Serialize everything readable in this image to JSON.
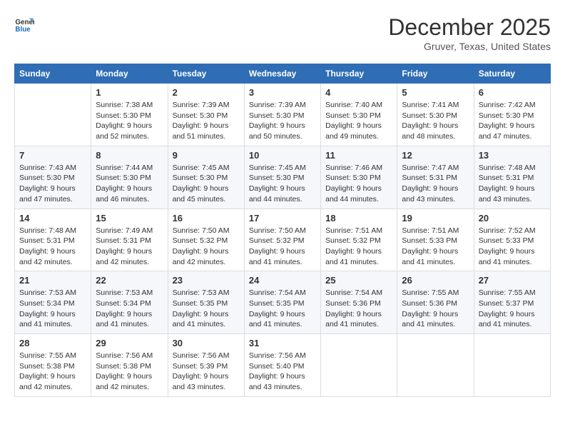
{
  "header": {
    "logo_general": "General",
    "logo_blue": "Blue",
    "month": "December 2025",
    "location": "Gruver, Texas, United States"
  },
  "days_of_week": [
    "Sunday",
    "Monday",
    "Tuesday",
    "Wednesday",
    "Thursday",
    "Friday",
    "Saturday"
  ],
  "weeks": [
    [
      {
        "day": "",
        "info": ""
      },
      {
        "day": "1",
        "info": "Sunrise: 7:38 AM\nSunset: 5:30 PM\nDaylight: 9 hours\nand 52 minutes."
      },
      {
        "day": "2",
        "info": "Sunrise: 7:39 AM\nSunset: 5:30 PM\nDaylight: 9 hours\nand 51 minutes."
      },
      {
        "day": "3",
        "info": "Sunrise: 7:39 AM\nSunset: 5:30 PM\nDaylight: 9 hours\nand 50 minutes."
      },
      {
        "day": "4",
        "info": "Sunrise: 7:40 AM\nSunset: 5:30 PM\nDaylight: 9 hours\nand 49 minutes."
      },
      {
        "day": "5",
        "info": "Sunrise: 7:41 AM\nSunset: 5:30 PM\nDaylight: 9 hours\nand 48 minutes."
      },
      {
        "day": "6",
        "info": "Sunrise: 7:42 AM\nSunset: 5:30 PM\nDaylight: 9 hours\nand 47 minutes."
      }
    ],
    [
      {
        "day": "7",
        "info": "Sunrise: 7:43 AM\nSunset: 5:30 PM\nDaylight: 9 hours\nand 47 minutes."
      },
      {
        "day": "8",
        "info": "Sunrise: 7:44 AM\nSunset: 5:30 PM\nDaylight: 9 hours\nand 46 minutes."
      },
      {
        "day": "9",
        "info": "Sunrise: 7:45 AM\nSunset: 5:30 PM\nDaylight: 9 hours\nand 45 minutes."
      },
      {
        "day": "10",
        "info": "Sunrise: 7:45 AM\nSunset: 5:30 PM\nDaylight: 9 hours\nand 44 minutes."
      },
      {
        "day": "11",
        "info": "Sunrise: 7:46 AM\nSunset: 5:30 PM\nDaylight: 9 hours\nand 44 minutes."
      },
      {
        "day": "12",
        "info": "Sunrise: 7:47 AM\nSunset: 5:31 PM\nDaylight: 9 hours\nand 43 minutes."
      },
      {
        "day": "13",
        "info": "Sunrise: 7:48 AM\nSunset: 5:31 PM\nDaylight: 9 hours\nand 43 minutes."
      }
    ],
    [
      {
        "day": "14",
        "info": "Sunrise: 7:48 AM\nSunset: 5:31 PM\nDaylight: 9 hours\nand 42 minutes."
      },
      {
        "day": "15",
        "info": "Sunrise: 7:49 AM\nSunset: 5:31 PM\nDaylight: 9 hours\nand 42 minutes."
      },
      {
        "day": "16",
        "info": "Sunrise: 7:50 AM\nSunset: 5:32 PM\nDaylight: 9 hours\nand 42 minutes."
      },
      {
        "day": "17",
        "info": "Sunrise: 7:50 AM\nSunset: 5:32 PM\nDaylight: 9 hours\nand 41 minutes."
      },
      {
        "day": "18",
        "info": "Sunrise: 7:51 AM\nSunset: 5:32 PM\nDaylight: 9 hours\nand 41 minutes."
      },
      {
        "day": "19",
        "info": "Sunrise: 7:51 AM\nSunset: 5:33 PM\nDaylight: 9 hours\nand 41 minutes."
      },
      {
        "day": "20",
        "info": "Sunrise: 7:52 AM\nSunset: 5:33 PM\nDaylight: 9 hours\nand 41 minutes."
      }
    ],
    [
      {
        "day": "21",
        "info": "Sunrise: 7:53 AM\nSunset: 5:34 PM\nDaylight: 9 hours\nand 41 minutes."
      },
      {
        "day": "22",
        "info": "Sunrise: 7:53 AM\nSunset: 5:34 PM\nDaylight: 9 hours\nand 41 minutes."
      },
      {
        "day": "23",
        "info": "Sunrise: 7:53 AM\nSunset: 5:35 PM\nDaylight: 9 hours\nand 41 minutes."
      },
      {
        "day": "24",
        "info": "Sunrise: 7:54 AM\nSunset: 5:35 PM\nDaylight: 9 hours\nand 41 minutes."
      },
      {
        "day": "25",
        "info": "Sunrise: 7:54 AM\nSunset: 5:36 PM\nDaylight: 9 hours\nand 41 minutes."
      },
      {
        "day": "26",
        "info": "Sunrise: 7:55 AM\nSunset: 5:36 PM\nDaylight: 9 hours\nand 41 minutes."
      },
      {
        "day": "27",
        "info": "Sunrise: 7:55 AM\nSunset: 5:37 PM\nDaylight: 9 hours\nand 41 minutes."
      }
    ],
    [
      {
        "day": "28",
        "info": "Sunrise: 7:55 AM\nSunset: 5:38 PM\nDaylight: 9 hours\nand 42 minutes."
      },
      {
        "day": "29",
        "info": "Sunrise: 7:56 AM\nSunset: 5:38 PM\nDaylight: 9 hours\nand 42 minutes."
      },
      {
        "day": "30",
        "info": "Sunrise: 7:56 AM\nSunset: 5:39 PM\nDaylight: 9 hours\nand 43 minutes."
      },
      {
        "day": "31",
        "info": "Sunrise: 7:56 AM\nSunset: 5:40 PM\nDaylight: 9 hours\nand 43 minutes."
      },
      {
        "day": "",
        "info": ""
      },
      {
        "day": "",
        "info": ""
      },
      {
        "day": "",
        "info": ""
      }
    ]
  ]
}
